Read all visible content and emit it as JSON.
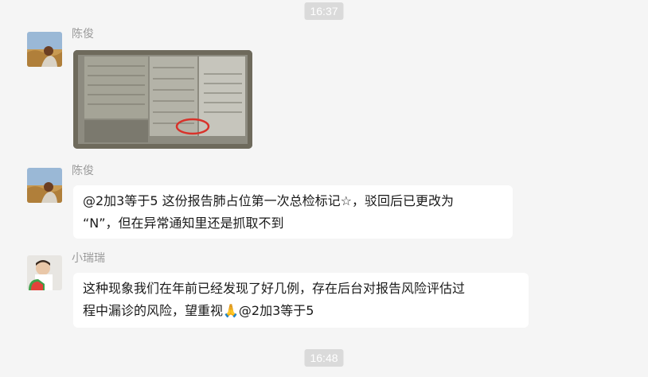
{
  "timestamps": [
    "16:37",
    "16:48"
  ],
  "messages": [
    {
      "sender": "陈俊",
      "type": "image",
      "avatar_icon": "wheat-field-avatar-icon"
    },
    {
      "sender": "陈俊",
      "type": "text",
      "avatar_icon": "wheat-field-avatar-icon",
      "lines": [
        "@2加3等于5 这份报告肺占位第一次总检标记☆，驳回后已更改为",
        "“N”，但在异常通知里还是抓取不到"
      ]
    },
    {
      "sender": "小瑞瑞",
      "type": "text",
      "avatar_icon": "child-watermelon-avatar-icon",
      "lines": [
        "这种现象我们在年前已经发现了好几例，存在后台对报告风险评估过",
        "程中漏诊的风险，望重视🙏@2加3等于5"
      ]
    }
  ]
}
